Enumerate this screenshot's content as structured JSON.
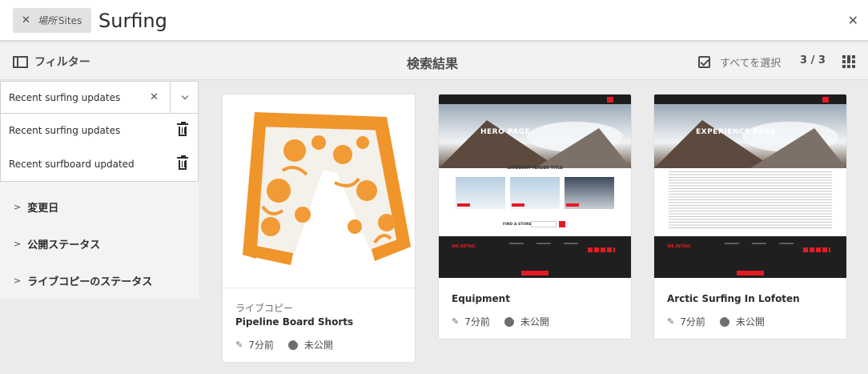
{
  "search": {
    "tag_location": "場所",
    "tag_value": "Sites",
    "query": "Surfing"
  },
  "toolbar": {
    "filter_label": "フィルター",
    "results_title": "検索結果",
    "select_all_label": "すべてを選択",
    "count": "3 / 3"
  },
  "saved_searches": {
    "current": "Recent surfing updates",
    "options": [
      "Recent surfing updates",
      "Recent surfboard updated"
    ]
  },
  "facets": [
    "変更日",
    "公開ステータス",
    "ライブコピーのステータス"
  ],
  "cards": [
    {
      "type": "ライブコピー",
      "title": "Pipeline Board Shorts",
      "modified": "7分前",
      "status": "未公開"
    },
    {
      "type": "",
      "title": "Equipment",
      "modified": "7分前",
      "status": "未公開",
      "hero_text": "HERO PAGE",
      "section_title": "CATEGORY TEASER TITLE",
      "find_label": "FIND A STORE"
    },
    {
      "type": "",
      "title": "Arctic Surfing In Lofoten",
      "modified": "7分前",
      "status": "未公開",
      "hero_text": "EXPERIENCE PAGE"
    }
  ],
  "colors": {
    "accent_red": "#e51b23",
    "short_orange": "#f0952a"
  }
}
